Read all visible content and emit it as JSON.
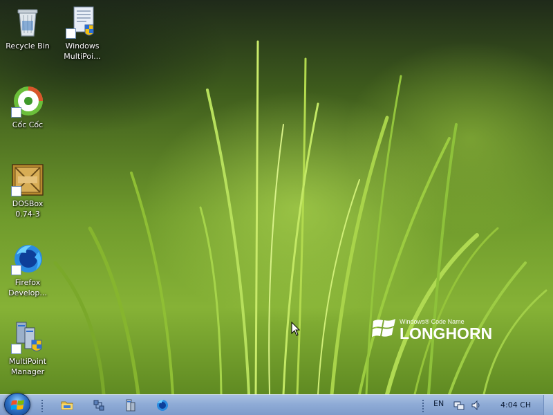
{
  "desktop": {
    "icons": [
      {
        "label": "Recycle Bin",
        "icon": "recycle-bin-icon"
      },
      {
        "label": "Windows MultiPoi...",
        "icon": "multipoint-document-icon"
      },
      {
        "label": "Cốc Cốc",
        "icon": "coccoc-icon"
      },
      {
        "label": "DOSBox 0.74-3",
        "icon": "dosbox-icon"
      },
      {
        "label": "Firefox Develop...",
        "icon": "firefox-developer-icon"
      },
      {
        "label": "MultiPoint Manager",
        "icon": "multipoint-manager-icon"
      }
    ],
    "watermark": {
      "small": "Windows® Code Name",
      "big": "LONGHORN"
    }
  },
  "taskbar": {
    "start": "windows-start-orb-icon",
    "quick_launch": [
      "folder-icon",
      "network-icon",
      "server-icon",
      "firefox-icon"
    ],
    "tray": {
      "language": "EN",
      "clock": "4:04 CH"
    }
  },
  "colors": {
    "taskbar_top": "#a9c1e2",
    "taskbar_bottom": "#7e9ccb",
    "icon_text": "#ffffff"
  }
}
